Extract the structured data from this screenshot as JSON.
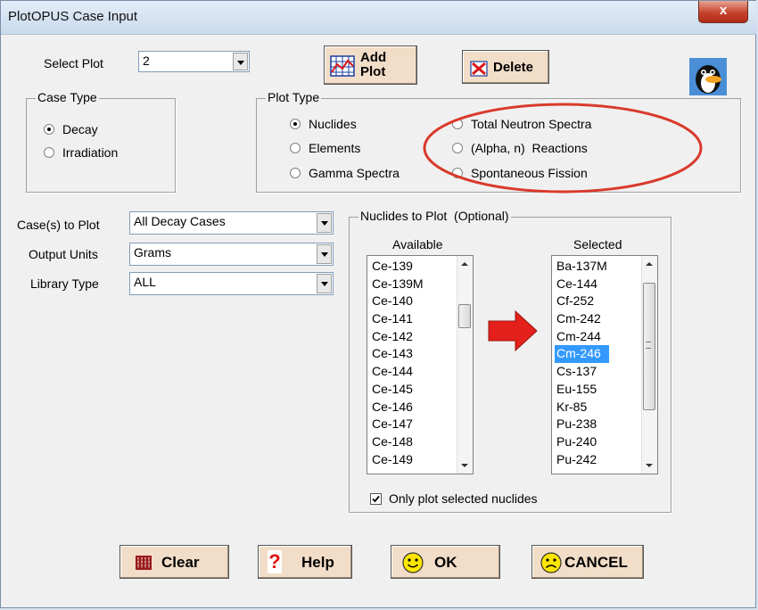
{
  "window": {
    "title": "PlotOPUS Case Input",
    "close_label": "x"
  },
  "select_plot": {
    "label": "Select Plot",
    "value": "2"
  },
  "toolbar": {
    "add_plot_label": "Add Plot",
    "delete_label": "Delete"
  },
  "case_type": {
    "title": "Case Type",
    "options": [
      {
        "label": "Decay",
        "selected": true
      },
      {
        "label": "Irradiation",
        "selected": false
      }
    ]
  },
  "plot_type": {
    "title": "Plot Type",
    "options": [
      {
        "label": "Nuclides",
        "selected": true
      },
      {
        "label": "Elements",
        "selected": false
      },
      {
        "label": "Gamma Spectra",
        "selected": false
      },
      {
        "label": "Total Neutron Spectra",
        "selected": false
      },
      {
        "label": "(Alpha, n)  Reactions",
        "selected": false
      },
      {
        "label": "Spontaneous Fission",
        "selected": false
      }
    ]
  },
  "annotation": {
    "color": "#d93a2b"
  },
  "fields": [
    {
      "label": "Case(s) to Plot",
      "value": "All Decay Cases"
    },
    {
      "label": "Output Units",
      "value": "Grams"
    },
    {
      "label": "Library Type",
      "value": "ALL"
    }
  ],
  "nuclides": {
    "title": "Nuclides to Plot  (Optional)",
    "available_label": "Available",
    "selected_label": "Selected",
    "available": [
      "Ce-139",
      "Ce-139M",
      "Ce-140",
      "Ce-141",
      "Ce-142",
      "Ce-143",
      "Ce-144",
      "Ce-145",
      "Ce-146",
      "Ce-147",
      "Ce-148",
      "Ce-149"
    ],
    "selected": [
      "Ba-137M",
      "Ce-144",
      "Cf-252",
      "Cm-242",
      "Cm-244",
      "Cm-246",
      "Cs-137",
      "Eu-155",
      "Kr-85",
      "Pu-238",
      "Pu-240",
      "Pu-242"
    ],
    "highlighted": "Cm-246",
    "only_selected_label": "Only plot selected nuclides",
    "only_selected_checked": true
  },
  "buttons": {
    "clear": "Clear",
    "help": "Help",
    "ok": "OK",
    "cancel": "CANCEL"
  },
  "colors": {
    "button_face": "#f2ddc8",
    "highlight": "#3399ff",
    "arrow": "#e3201b"
  }
}
